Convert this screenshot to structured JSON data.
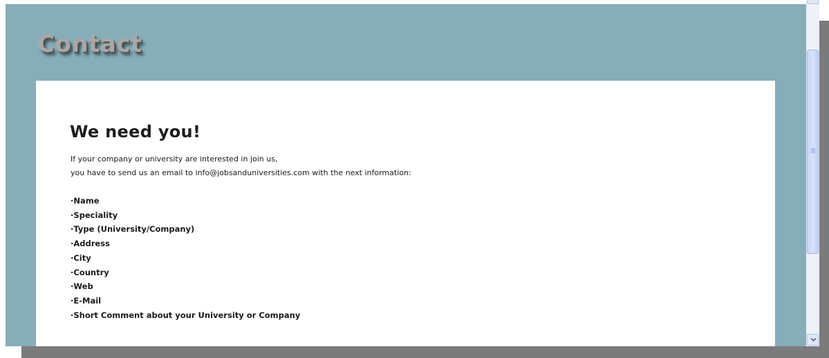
{
  "header": {
    "title": "Contact"
  },
  "content": {
    "heading": "We need you!",
    "intro_lines": [
      "If your company or university are interested in join us,",
      "you have to send us an email to info@jobsanduniversities.com with the next information:"
    ],
    "fields": [
      "·Name",
      "·Speciality",
      "·Type (University/Company)",
      "·Address",
      "·City",
      "·Country",
      "·Web",
      "·E-Mail",
      "·Short Comment about your University or Company"
    ]
  },
  "scrollbar": {
    "position": 0.2
  }
}
